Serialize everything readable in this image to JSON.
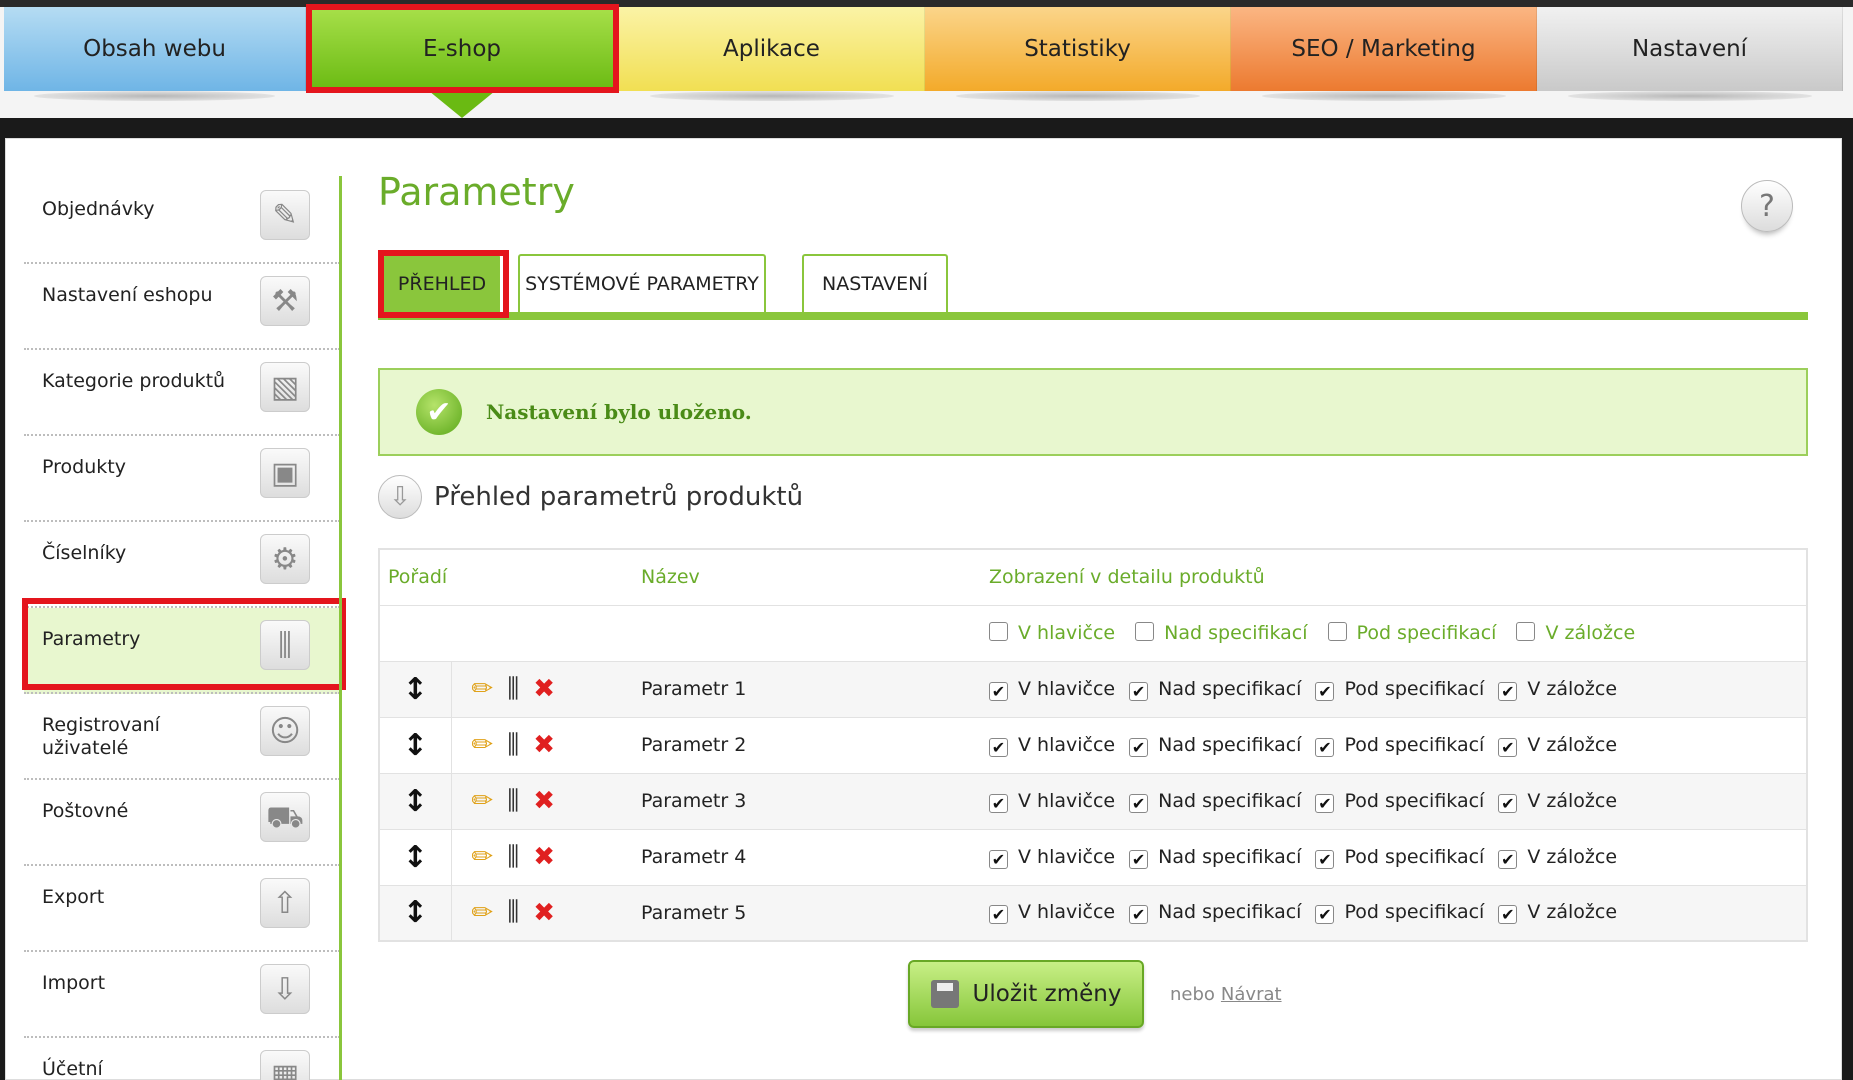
{
  "topnav": {
    "tabs": [
      {
        "label": "Obsah webu"
      },
      {
        "label": "E-shop"
      },
      {
        "label": "Aplikace"
      },
      {
        "label": "Statistiky"
      },
      {
        "label": "SEO / Marketing"
      },
      {
        "label": "Nastavení"
      }
    ],
    "active": "E-shop"
  },
  "sidebar": {
    "items": [
      {
        "label": "Objednávky",
        "icon": "clipboard-icon"
      },
      {
        "label": "Nastavení eshopu",
        "icon": "tools-icon"
      },
      {
        "label": "Kategorie produktů",
        "icon": "boxes-icon"
      },
      {
        "label": "Produkty",
        "icon": "box-icon"
      },
      {
        "label": "Číselníky",
        "icon": "gears-icon"
      },
      {
        "label": "Parametry",
        "icon": "sliders-icon"
      },
      {
        "label": "Registrovaní uživatelé",
        "icon": "users-icon"
      },
      {
        "label": "Poštovné",
        "icon": "truck-icon"
      },
      {
        "label": "Export",
        "icon": "upload-icon"
      },
      {
        "label": "Import",
        "icon": "download-icon"
      },
      {
        "label": "Účetní",
        "icon": "calculator-icon"
      }
    ],
    "active": "Parametry"
  },
  "main": {
    "title": "Parametry",
    "help": "?",
    "tabs": [
      {
        "label": "PŘEHLED"
      },
      {
        "label": "SYSTÉMOVÉ PARAMETRY"
      },
      {
        "label": "NASTAVENÍ"
      }
    ],
    "message": "Nastavení bylo uloženo.",
    "section_title": "Přehled parametrů produktů",
    "table": {
      "headers": {
        "order": "Pořadí",
        "name": "Název",
        "display": "Zobrazení v detailu produktů"
      },
      "options": [
        "V hlavičce",
        "Nad specifikací",
        "Pod specifikací",
        "V záložce"
      ],
      "rows": [
        {
          "name": "Parametr 1",
          "checked": [
            true,
            true,
            true,
            true
          ]
        },
        {
          "name": "Parametr 2",
          "checked": [
            true,
            true,
            true,
            true
          ]
        },
        {
          "name": "Parametr 3",
          "checked": [
            true,
            true,
            true,
            true
          ]
        },
        {
          "name": "Parametr 4",
          "checked": [
            true,
            true,
            true,
            true
          ]
        },
        {
          "name": "Parametr 5",
          "checked": [
            true,
            true,
            true,
            true
          ]
        }
      ]
    },
    "save_label": "Uložit změny",
    "or_text": "nebo",
    "back_label": "Návrat"
  },
  "colors": {
    "accent_green": "#8ac63c",
    "highlight_red": "#e4151d"
  }
}
